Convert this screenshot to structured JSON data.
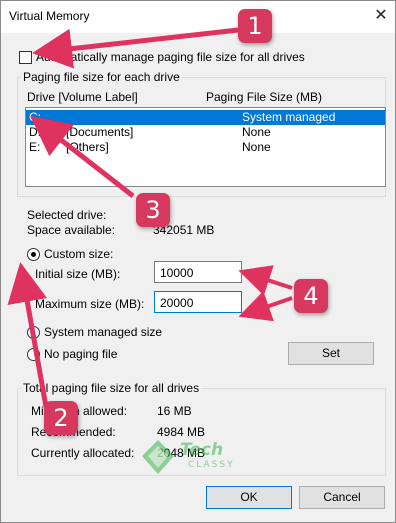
{
  "window": {
    "title": "Virtual Memory",
    "close_glyph": "✕"
  },
  "auto_manage": {
    "label": "Automatically manage paging file size for all drives",
    "checked": false
  },
  "paging_group": {
    "legend": "Paging file size for each drive",
    "col_drive": "Drive  [Volume Label]",
    "col_size": "Paging File Size (MB)",
    "rows": [
      {
        "drive": "C:",
        "label": "",
        "size": "System managed",
        "selected": true
      },
      {
        "drive": "D:",
        "label": "[Documents]",
        "size": "None",
        "selected": false
      },
      {
        "drive": "E:",
        "label": "[Others]",
        "size": "None",
        "selected": false
      }
    ]
  },
  "selected": {
    "drive_label": "Selected drive:",
    "drive_value": "C:",
    "space_label": "Space available:",
    "space_value": "342051 MB"
  },
  "custom": {
    "label": "Custom size:",
    "initial_label": "Initial size (MB):",
    "initial_value": "10000",
    "max_label": "Maximum size (MB):",
    "max_value": "20000"
  },
  "system_managed": {
    "label": "System managed size"
  },
  "no_paging": {
    "label": "No paging file"
  },
  "set_button": "Set",
  "totals": {
    "legend": "Total paging file size for all drives",
    "min_label": "Minimum allowed:",
    "min_value": "16 MB",
    "rec_label": "Recommended:",
    "rec_value": "4984 MB",
    "cur_label": "Currently allocated:",
    "cur_value": "2048 MB"
  },
  "buttons": {
    "ok": "OK",
    "cancel": "Cancel"
  },
  "badges": [
    "1",
    "2",
    "3",
    "4"
  ],
  "watermark": {
    "line1": "Tech",
    "line2": "CLASSY"
  },
  "colors": {
    "accent": "#0078d7",
    "badge": "#d7385d",
    "arrow": "#e0325e",
    "watermark": "#3bb54a"
  }
}
